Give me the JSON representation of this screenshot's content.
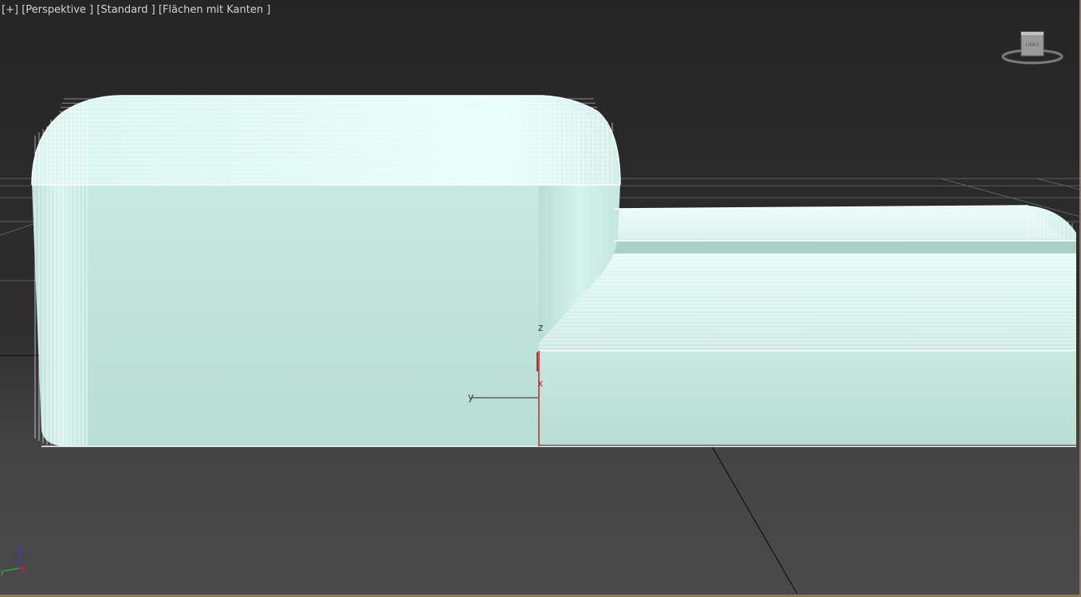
{
  "viewport": {
    "menu_label": "[+]",
    "view_label": "[Perspektive ]",
    "shading_label": "[Standard ]",
    "display_label": "[Flächen mit Kanten ]"
  },
  "viewcube": {
    "face_label": "LINKS",
    "icon": "viewcube-icon"
  },
  "gizmo": {
    "z_label": "z",
    "y_label": "y",
    "x_label": "x"
  },
  "world_axis": {
    "z_label": "z",
    "y_label": "y",
    "x_label": "x"
  },
  "colors": {
    "background_top": "#262626",
    "background_bottom": "#494949",
    "mesh_fill": "#c0e4dc",
    "mesh_edges": "#ffffff",
    "grid": "#6a6a6a",
    "x_axis": "#c0282e",
    "y_axis": "#3aa23a",
    "z_axis": "#3a3ad0",
    "frame_border": "#8c7a55"
  }
}
